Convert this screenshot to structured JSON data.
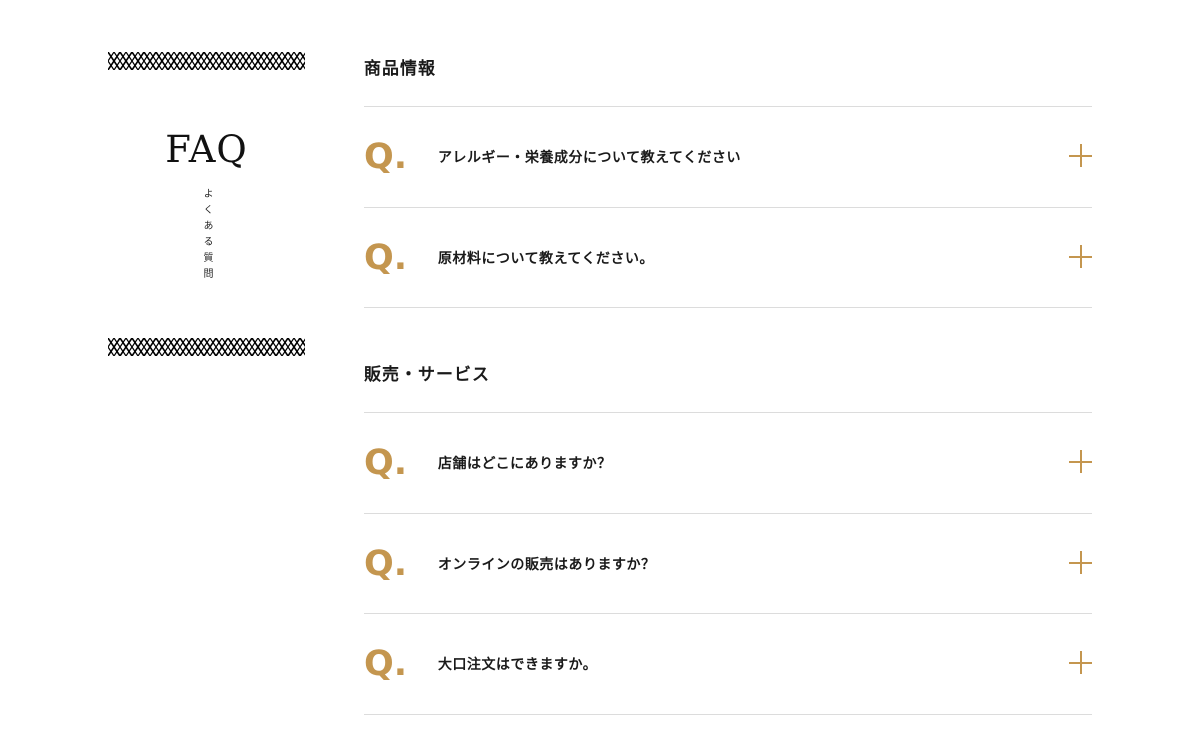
{
  "sidebar": {
    "title": "FAQ",
    "subtitle": "よくある質問"
  },
  "sections": [
    {
      "title": "商品情報",
      "items": [
        {
          "q": "Q.",
          "text": "アレルギー・栄養成分について教えてください"
        },
        {
          "q": "Q.",
          "text": "原材料について教えてください。"
        }
      ]
    },
    {
      "title": "販売・サービス",
      "items": [
        {
          "q": "Q.",
          "text": "店舗はどこにありますか？"
        },
        {
          "q": "Q.",
          "text": "オンラインの販売はありますか？"
        },
        {
          "q": "Q.",
          "text": "大口注文はできますか。"
        }
      ]
    }
  ],
  "icons": {
    "expand": "plus-icon",
    "ornament": "lattice-ornament"
  },
  "colors": {
    "accent": "#c4964f",
    "rule": "#dcdcdc",
    "text": "#1a1a1a"
  }
}
